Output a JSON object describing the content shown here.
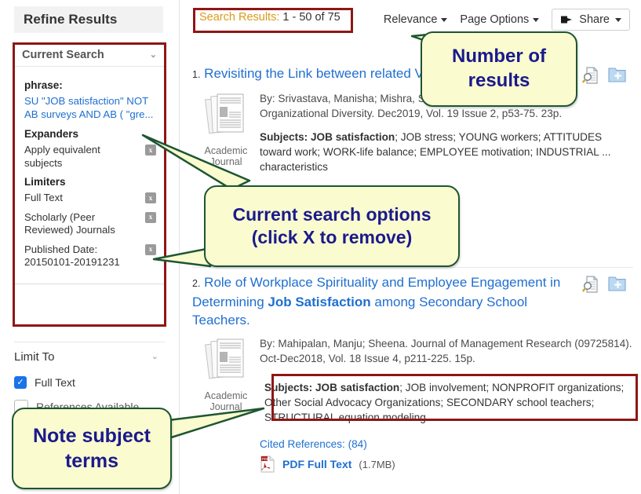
{
  "window": {
    "collapse_label": "«"
  },
  "sidebar": {
    "header": "Refine Results",
    "current_search": {
      "title": "Current Search",
      "chevron": "⌄",
      "phrase_label": "phrase:",
      "phrase_value": "SU \"JOB satisfaction\" NOT AB surveys AND AB ( \"gre...",
      "expanders_label": "Expanders",
      "expanders": [
        {
          "label": "Apply equivalent subjects",
          "remove": "x"
        }
      ],
      "limiters_label": "Limiters",
      "limiters": [
        {
          "label": "Full Text",
          "remove": "x"
        },
        {
          "label": "Scholarly (Peer Reviewed) Journals",
          "remove": "x"
        },
        {
          "label": "Published Date: 20150101-20191231",
          "remove": "x"
        }
      ]
    },
    "limit_to": {
      "title": "Limit To",
      "chevron": "⌄",
      "options": [
        {
          "label": "Full Text",
          "checked": "✓"
        },
        {
          "label": "References Available",
          "checked": ""
        }
      ]
    }
  },
  "toolbar": {
    "results_label": "Search Results:",
    "results_range": " 1 - 50 of 75",
    "sort_label": "Relevance",
    "page_options_label": "Page Options",
    "share_label": "Share",
    "share_icon": "share-icon"
  },
  "results": [
    {
      "number": "1.",
      "title_plain_1": "Revisiting the Link between ",
      "title_plain_2": "related Variables.",
      "thumb_caption_line1": "Academic",
      "thumb_caption_line2": "Journal",
      "byline": "By: Srivastava, Manisha; Mishra, Sasmita. International Journal of Organizational Diversity. Dec2019, Vol. 19 Issue 2, p53-75. 23p.",
      "subjects_label": "Subjects:",
      "subjects_bold": "JOB satisfaction",
      "subjects_rest": "; JOB stress; YOUNG workers; ATTITUDES toward work; WORK-life balance; EMPLOYEE motivation; INDUSTRIAL ... characteristics",
      "preview_icon": "preview-icon",
      "addfolder_icon": "add-to-folder-icon"
    },
    {
      "number": "2.",
      "title_part1": "Role of Workplace Spirituality and Employee Engagement in Determining ",
      "title_bold": "Job Satisfaction",
      "title_part2": " among Secondary School Teachers.",
      "thumb_caption_line1": "Academic",
      "thumb_caption_line2": "Journal",
      "byline": "By: Mahipalan, Manju; Sheena. Journal of Management Research (09725814). Oct-Dec2018, Vol. 18 Issue 4, p211-225. 15p.",
      "subjects_label": "Subjects:",
      "subjects_bold": "JOB satisfaction",
      "subjects_rest": "; JOB involvement; NONPROFIT organizations; Other Social Advocacy Organizations; SECONDARY school teachers; STRUCTURAL equation modeling",
      "cited_references": "Cited References: (84)",
      "pdf_label": "PDF Full Text",
      "pdf_size": "(1.7MB)",
      "pdf_icon": "pdf-icon",
      "preview_icon": "preview-icon",
      "addfolder_icon": "add-to-folder-icon"
    }
  ],
  "callouts": [
    {
      "line1": "Number of",
      "line2": "results"
    },
    {
      "line1": "Current search options",
      "line2": "(click X to remove)"
    },
    {
      "line1": "Note subject",
      "line2": "terms"
    }
  ],
  "colors": {
    "annotation_border": "#8f1616",
    "callout_fill": "#fbfbd0",
    "callout_border": "#1d5632",
    "callout_text": "#1a1a8c",
    "link": "#1f6fd0",
    "results_label": "#d99b18"
  }
}
